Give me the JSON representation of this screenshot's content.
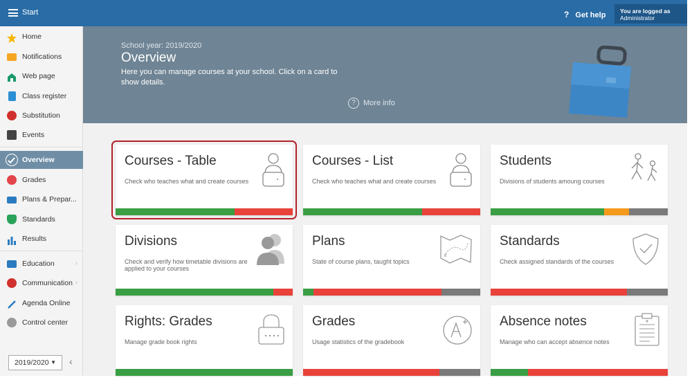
{
  "topbar": {
    "start_label": "Start",
    "help_label": "Get help",
    "help_icon": "?",
    "login_line1": "You are logged as",
    "login_line2": "Administrator"
  },
  "sidebar": {
    "items": [
      {
        "label": "Home",
        "icon": "star-icon",
        "color": "#f5b800"
      },
      {
        "label": "Notifications",
        "icon": "envelope-icon",
        "color": "#f5a623"
      },
      {
        "label": "Web page",
        "icon": "house-icon",
        "color": "#1a9a6b"
      },
      {
        "label": "Class register",
        "icon": "register-icon",
        "color": "#2a8fd4"
      },
      {
        "label": "Substitution",
        "icon": "person-icon",
        "color": "#d0312d"
      },
      {
        "label": "Events",
        "icon": "calendar-icon",
        "color": "#555555"
      },
      {
        "label": "Overview",
        "icon": "check-circle-icon",
        "color": "#ffffff"
      },
      {
        "label": "Grades",
        "icon": "grades-icon",
        "color": "#e2454a"
      },
      {
        "label": "Plans & Prepar...",
        "icon": "briefcase-icon",
        "color": "#2a7bbf"
      },
      {
        "label": "Standards",
        "icon": "shield-icon",
        "color": "#2aa35a"
      },
      {
        "label": "Results",
        "icon": "bar-chart-icon",
        "color": "#2a7bbf"
      },
      {
        "label": "Education",
        "icon": "book-icon",
        "color": "#2a7bbf"
      },
      {
        "label": "Communication",
        "icon": "chat-icon",
        "color": "#d0312d"
      },
      {
        "label": "Agenda Online",
        "icon": "pen-icon",
        "color": "#2a7bbf"
      },
      {
        "label": "Control center",
        "icon": "gear-icon",
        "color": "#888888"
      }
    ],
    "year": "2019/2020"
  },
  "banner": {
    "school_year": "School year: 2019/2020",
    "title": "Overview",
    "description": "Here you can manage courses at your school. Click on a card to show details.",
    "more_info": "More info"
  },
  "colors": {
    "green": "#3a9e44",
    "red": "#e8423a",
    "orange": "#f59a1c",
    "gray": "#7a7a7a"
  },
  "cards": [
    {
      "title": "Courses - Table",
      "desc": "Check who teaches what and create courses",
      "icon": "teacher-desk-icon",
      "bar": [
        [
          "green",
          0.67
        ],
        [
          "red",
          0.33
        ]
      ]
    },
    {
      "title": "Courses - List",
      "desc": "Check who teaches what and create courses",
      "icon": "teacher-desk-icon",
      "bar": [
        [
          "green",
          0.67
        ],
        [
          "red",
          0.33
        ]
      ]
    },
    {
      "title": "Students",
      "desc": "Divisions of students amoung courses",
      "icon": "walking-students-icon",
      "bar": [
        [
          "green",
          0.64
        ],
        [
          "orange",
          0.14
        ],
        [
          "gray",
          0.22
        ]
      ]
    },
    {
      "title": "Divisions",
      "desc": "Check and verify how timetable divisions are applied to your courses",
      "icon": "people-silhouette-icon",
      "bar": [
        [
          "green",
          0.89
        ],
        [
          "red",
          0.11
        ]
      ]
    },
    {
      "title": "Plans",
      "desc": "State of course plans, taught topics",
      "icon": "treasure-map-icon",
      "bar": [
        [
          "green",
          0.06
        ],
        [
          "red",
          0.72
        ],
        [
          "gray",
          0.22
        ]
      ]
    },
    {
      "title": "Standards",
      "desc": "Check assigned standards of the courses",
      "icon": "shield-check-icon",
      "bar": [
        [
          "red",
          0.77
        ],
        [
          "gray",
          0.23
        ]
      ]
    },
    {
      "title": "Rights: Grades",
      "desc": "Manage grade book rights",
      "icon": "padlock-icon",
      "bar": [
        [
          "green",
          1.0
        ]
      ]
    },
    {
      "title": "Grades",
      "desc": "Usage statistics of the gradebook",
      "icon": "grade-a-plus-icon",
      "bar": [
        [
          "red",
          0.77
        ],
        [
          "gray",
          0.23
        ]
      ]
    },
    {
      "title": "Absence notes",
      "desc": "Manage who can accept absence notes",
      "icon": "clipboard-icon",
      "bar": [
        [
          "green",
          0.21
        ],
        [
          "red",
          0.79
        ]
      ]
    }
  ]
}
